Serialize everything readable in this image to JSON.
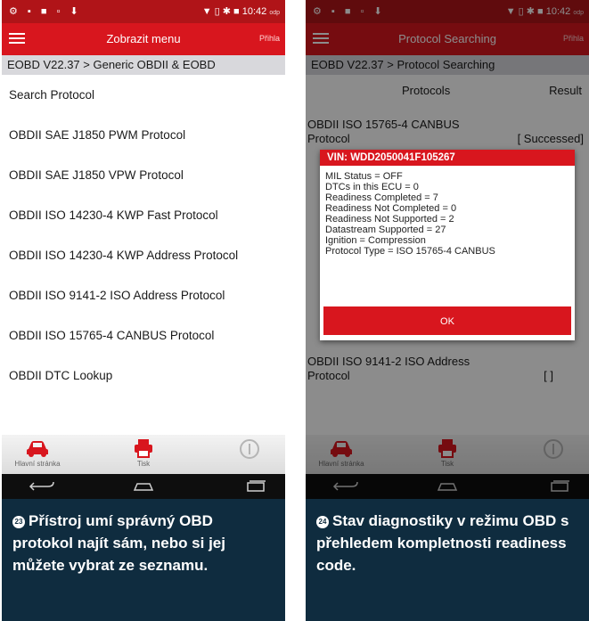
{
  "left": {
    "status": {
      "icons": "⚙ ▪ ■ ▫ ⬇",
      "right": "▼ ▯ ✱ ■ 10:42",
      "right_sub": "odp"
    },
    "app_bar": {
      "title": "Zobrazit menu",
      "action": "Přihla"
    },
    "breadcrumb": "EOBD V22.37 > Generic OBDII & EOBD",
    "items": [
      "Search Protocol",
      "OBDII SAE J1850 PWM Protocol",
      "OBDII SAE J1850 VPW Protocol",
      "OBDII ISO 14230-4 KWP Fast Protocol",
      "OBDII ISO 14230-4 KWP Address Protocol",
      "OBDII ISO 9141-2 ISO Address Protocol",
      "OBDII ISO 15765-4 CANBUS Protocol",
      "OBDII DTC Lookup"
    ],
    "bottom": {
      "home": "Hlavní stránka",
      "print": "Tisk",
      "info": ""
    },
    "caption": {
      "num": "23",
      "text": "Přístroj umí správný OBD protokol najít sám, nebo si jej můžete vybrat ze seznamu."
    }
  },
  "right": {
    "status": {
      "icons": "⚙ ▪ ■ ▫ ⬇",
      "right": "▼ ▯ ✱ ■ 10:42",
      "right_sub": "odp"
    },
    "app_bar": {
      "title": "Protocol Searching",
      "action": "Přihla"
    },
    "breadcrumb": "EOBD V22.37 > Protocol Searching",
    "columns": {
      "protocols": "Protocols",
      "result": "Result"
    },
    "rows": [
      {
        "name": "OBDII ISO 15765-4 CANBUS Protocol",
        "result": "[ Successed]"
      },
      {
        "name": "OBDII ISO 9141-2 ISO Address Protocol",
        "result": "[ ]"
      }
    ],
    "dialog": {
      "title": "VIN: WDD2050041F105267",
      "lines": [
        "MIL Status = OFF",
        "DTCs in this ECU = 0",
        "Readiness Completed = 7",
        "Readiness Not Completed = 0",
        "Readiness Not Supported = 2",
        "Datastream Supported = 27",
        "Ignition = Compression",
        "Protocol Type = ISO 15765-4 CANBUS"
      ],
      "ok": "OK"
    },
    "bottom": {
      "home": "Hlavní stránka",
      "print": "Tisk",
      "info": ""
    },
    "caption": {
      "num": "24",
      "text": "Stav diagnostiky v režimu OBD s přehledem komplet­nosti readiness code."
    }
  }
}
